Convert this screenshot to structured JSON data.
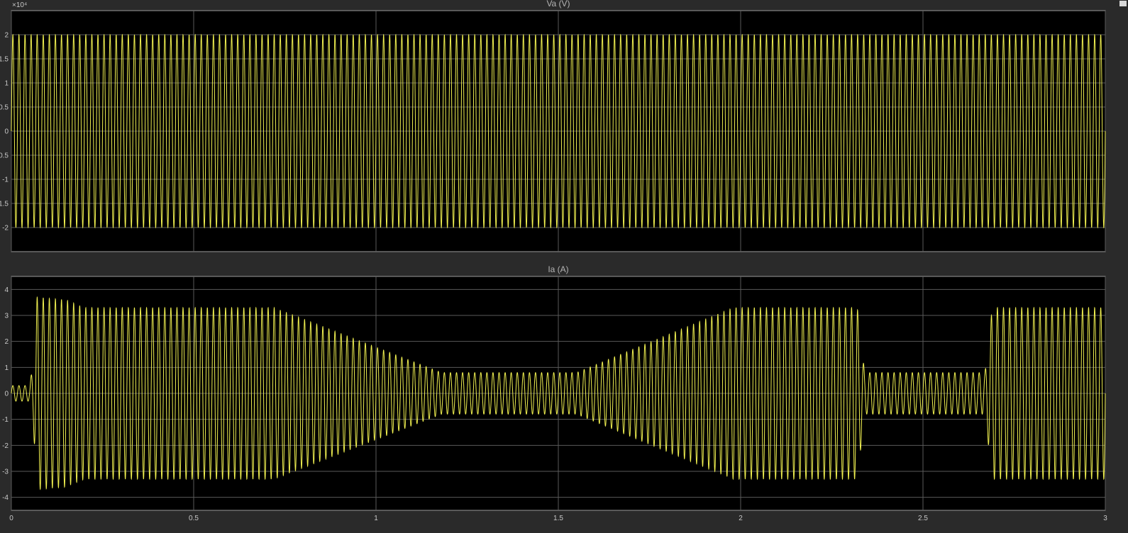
{
  "colors": {
    "background": "#2a2a2a",
    "axes": "#000000",
    "trace": "#f0f050",
    "grid": "#5a5a5a",
    "text": "#c8c8c8"
  },
  "chart_data": [
    {
      "type": "line",
      "title": "Va (V)",
      "xlabel": "",
      "ylabel": "",
      "xlim": [
        0,
        3
      ],
      "ylim": [
        -2.5,
        2.5
      ],
      "grid": true,
      "exponent_label": "×10⁴",
      "y_ticks": [
        2,
        1.5,
        1,
        0.5,
        0,
        -0.5,
        -1,
        -1.5,
        -2
      ],
      "y_tick_labels": [
        "2",
        "1.5",
        "1",
        "0.5",
        "0",
        "0.5",
        "-1",
        "1.5",
        "-2"
      ],
      "series": [
        {
          "frequency_hz": 60,
          "amplitude": 2,
          "envelope": [
            [
              0,
              2
            ],
            [
              3,
              2
            ]
          ]
        }
      ]
    },
    {
      "type": "line",
      "title": "Ia (A)",
      "xlabel": "",
      "ylabel": "",
      "xlim": [
        0,
        3
      ],
      "ylim": [
        -4.5,
        4.5
      ],
      "grid": true,
      "y_ticks": [
        4,
        3,
        2,
        1,
        0,
        -1,
        -2,
        -3,
        -4
      ],
      "y_tick_labels": [
        "4",
        "3",
        "2",
        "1",
        "0",
        "-1",
        "-2",
        "-3",
        "-4"
      ],
      "x_ticks": [
        0,
        0.5,
        1,
        1.5,
        2,
        2.5,
        3
      ],
      "x_tick_labels": [
        "0",
        "0.5",
        "1",
        "1.5",
        "2",
        "2.5",
        "3"
      ],
      "series": [
        {
          "frequency_hz": 60,
          "envelope": [
            [
              0,
              0.3
            ],
            [
              0.05,
              0.3
            ],
            [
              0.06,
              1.2
            ],
            [
              0.07,
              3.7
            ],
            [
              0.15,
              3.6
            ],
            [
              0.2,
              3.3
            ],
            [
              0.72,
              3.3
            ],
            [
              1.18,
              0.8
            ],
            [
              1.55,
              0.8
            ],
            [
              1.98,
              3.3
            ],
            [
              2.32,
              3.3
            ],
            [
              2.34,
              0.8
            ],
            [
              2.67,
              0.8
            ],
            [
              2.69,
              3.3
            ],
            [
              3,
              3.3
            ]
          ]
        }
      ]
    }
  ]
}
